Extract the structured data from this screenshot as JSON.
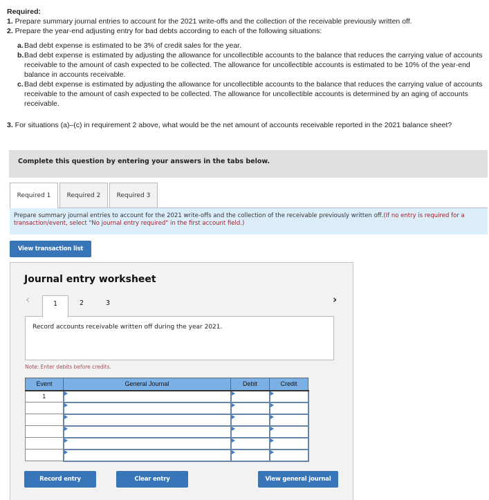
{
  "requirements": {
    "title": "Required:",
    "items": [
      {
        "num": "1.",
        "text": " Prepare summary journal entries to account for the 2021 write-offs and the collection of the receivable previously written off."
      },
      {
        "num": "2.",
        "text": " Prepare the year-end adjusting entry for bad debts according to each of the following situations:"
      }
    ],
    "situations": [
      {
        "letter": "a.",
        "text": "Bad debt expense is estimated to be 3% of credit sales for the year."
      },
      {
        "letter": "b.",
        "text": "Bad debt expense is estimated by adjusting the allowance for uncollectible accounts to the balance that reduces the carrying value of accounts receivable to the amount of cash expected to be collected. The allowance for uncollectible accounts is estimated to be 10% of the year-end balance in accounts receivable."
      },
      {
        "letter": "c.",
        "text": "Bad debt expense is estimated by adjusting the allowance for uncollectible accounts to the balance that reduces the carrying value of accounts receivable to the amount of cash expected to be collected. The allowance for uncollectible accounts is determined by an aging of accounts receivable."
      }
    ],
    "item3": {
      "num": "3.",
      "text": " For situations (a)–(c) in requirement 2 above, what would be the net amount of accounts receivable reported in the 2021 balance sheet?"
    }
  },
  "complete_banner": "Complete this question by entering your answers in the tabs below.",
  "tabs": [
    {
      "label": "Required 1",
      "active": true
    },
    {
      "label": "Required 2",
      "active": false
    },
    {
      "label": "Required 3",
      "active": false
    }
  ],
  "instruction": {
    "main": "Prepare summary journal entries to account for the 2021 write-offs and the collection of the receivable previously written off.",
    "note": "(If no entry is required for a transaction/event, select \"No journal entry required\" in the first account field.)"
  },
  "view_transaction_list": "View transaction list",
  "worksheet": {
    "title": "Journal entry worksheet",
    "prev_icon": "chevron-left-icon",
    "next_icon": "chevron-right-icon",
    "entry_tabs": [
      "1",
      "2",
      "3"
    ],
    "active_entry": "1",
    "description": "Record accounts receivable written off during the year 2021.",
    "note": "Note: Enter debits before credits.",
    "table": {
      "headers": [
        "Event",
        "General Journal",
        "Debit",
        "Credit"
      ],
      "rows": [
        {
          "event": "1",
          "account": "",
          "debit": "",
          "credit": ""
        },
        {
          "event": "",
          "account": "",
          "debit": "",
          "credit": ""
        },
        {
          "event": "",
          "account": "",
          "debit": "",
          "credit": ""
        },
        {
          "event": "",
          "account": "",
          "debit": "",
          "credit": ""
        },
        {
          "event": "",
          "account": "",
          "debit": "",
          "credit": ""
        },
        {
          "event": "",
          "account": "",
          "debit": "",
          "credit": ""
        }
      ]
    },
    "buttons": {
      "record": "Record entry",
      "clear": "Clear entry",
      "view_journal": "View general journal"
    }
  },
  "colors": {
    "button_blue": "#3874b8",
    "header_blue": "#7ab0e4",
    "instruction_bg": "#dceefa",
    "note_red": "#a0202a"
  }
}
